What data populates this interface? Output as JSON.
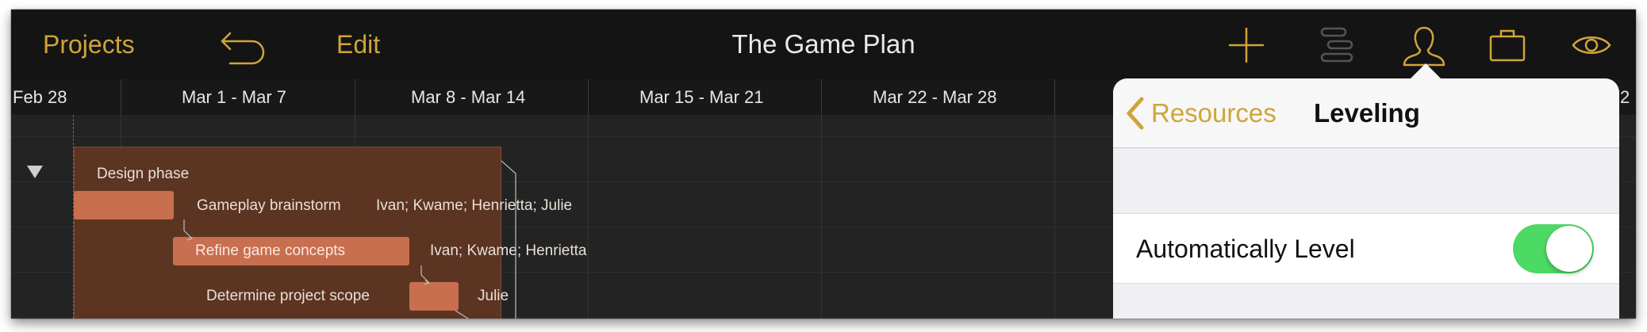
{
  "toolbar": {
    "projects_label": "Projects",
    "edit_label": "Edit",
    "title": "The Game Plan",
    "icons": [
      "undo-icon",
      "add-icon",
      "gantt-view-icon",
      "resources-icon",
      "briefcase-icon",
      "eye-icon"
    ]
  },
  "colors": {
    "accent": "#d0a43a",
    "toolbar_bg": "#141414",
    "gantt_bg": "#232323",
    "group_bar": "#5c3422",
    "task_bar": "#c86f4f",
    "toggle_on": "#4cd964"
  },
  "timescale": {
    "labels": [
      "Feb 28",
      "Mar 1 - Mar 7",
      "Mar 8 - Mar 14",
      "Mar 15 - Mar 21",
      "Mar 22 - Mar 28"
    ],
    "cut_label": "2"
  },
  "gantt": {
    "group": {
      "name": "Design phase"
    },
    "tasks": [
      {
        "name": "Gameplay brainstorm",
        "resources": "Ivan; Kwame; Henrietta; Julie"
      },
      {
        "name": "Refine game concepts",
        "resources": "Ivan; Kwame; Henrietta"
      },
      {
        "name": "Determine project scope",
        "resources": "Julie"
      }
    ]
  },
  "popover": {
    "back_label": "Resources",
    "title": "Leveling",
    "setting_label": "Automatically Level",
    "setting_on": true
  }
}
